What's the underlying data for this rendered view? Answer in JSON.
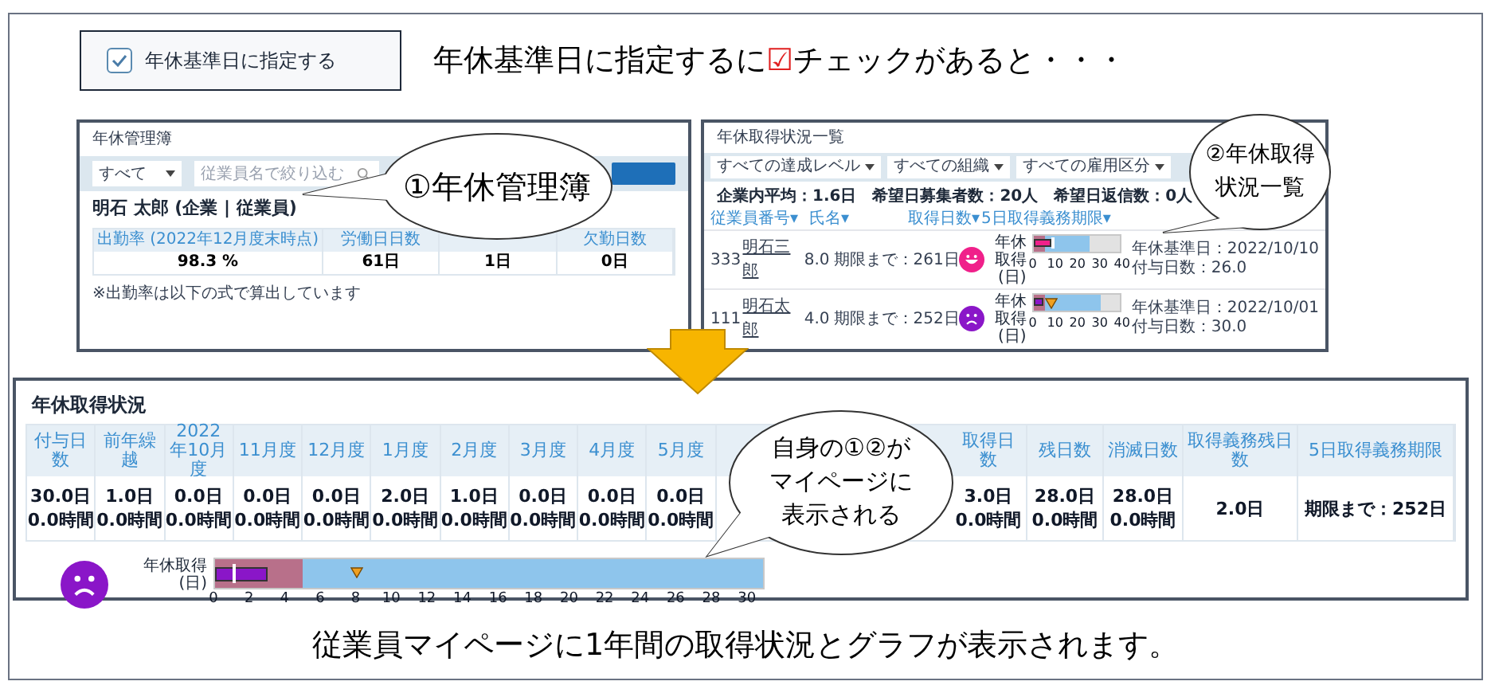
{
  "top": {
    "checkbox_card": {
      "label": "年休基準日に指定する",
      "checked": true
    },
    "headline": {
      "before": "年休基準日に指定するに",
      "mark": "☑",
      "after": "チェックがあると・・・"
    }
  },
  "ledger": {
    "title": "年休管理簿",
    "filter": "すべて",
    "search": {
      "placeholder": "従業員名で絞り込む"
    },
    "employee": "明石 太郎 (企業 | 従業員)",
    "stats": [
      {
        "header": "出勤率 (2022年12月度末時点)",
        "value": "98.3 %"
      },
      {
        "header": "労働日日数",
        "value": "61日"
      },
      {
        "value": "1日"
      },
      {
        "header": "欠勤日数",
        "value": "0日"
      }
    ],
    "note": "※出勤率は以下の式で算出しています"
  },
  "status_list": {
    "title": "年休取得状況一覧",
    "filters": [
      "すべての達成レベル",
      "すべての組織",
      "すべての雇用区分"
    ],
    "summary": "企業内平均：1.6日　希望日募集者数：20人　希望日返信数：0人",
    "columns": [
      "従業員番号▾",
      "氏名▾",
      "取得日数▾",
      "5日取得義務期限▾"
    ],
    "rows": [
      {
        "number": "333",
        "name": "明石三郎",
        "days": "8.0",
        "deadline": "期限まで：261日",
        "kind": "happy",
        "color": "#f0208a",
        "base_date": "年休基準日：2022/10/10",
        "granted": "付与日数：26.0",
        "gauge": {
          "label": "年休取得(日)",
          "level": 0.2,
          "segments": [
            {
              "level": 0.125
            },
            {
              "level": 0.65
            },
            {
              "level": 1
            }
          ],
          "line": {
            "level": 0.2
          },
          "ticks": [
            "0",
            "10",
            "20",
            "30",
            "40"
          ]
        }
      },
      {
        "number": "111",
        "name": "明石太郎",
        "days": "4.0",
        "deadline": "期限まで：252日",
        "kind": "sad",
        "color": "#8a16c8",
        "base_date": "年休基準日：2022/10/01",
        "granted": "付与日数：30.0",
        "gauge": {
          "label": "年休取得(日)",
          "level": 0.1,
          "segments": [
            {
              "level": 0.125
            },
            {
              "level": 0.775
            },
            {
              "level": 1
            }
          ],
          "marker": {
            "level": 0.2
          },
          "ticks": [
            "0",
            "10",
            "20",
            "30",
            "40"
          ]
        }
      }
    ]
  },
  "my_page": {
    "title": "年休取得状況",
    "columns": [
      {
        "header": "付与日数",
        "lines": [
          "30.0日",
          "0.0時間"
        ]
      },
      {
        "header": "前年繰越",
        "lines": [
          "1.0日",
          "0.0時間"
        ]
      },
      {
        "header": "2022年10月度",
        "lines": [
          "0.0日",
          "0.0時間"
        ]
      },
      {
        "header": "11月度",
        "lines": [
          "0.0日",
          "0.0時間"
        ]
      },
      {
        "header": "12月度",
        "lines": [
          "0.0日",
          "0.0時間"
        ]
      },
      {
        "header": "1月度",
        "lines": [
          "2.0日",
          "0.0時間"
        ]
      },
      {
        "header": "2月度",
        "lines": [
          "1.0日",
          "0.0時間"
        ]
      },
      {
        "header": "3月度",
        "lines": [
          "0.0日",
          "0.0時間"
        ]
      },
      {
        "header": "4月度",
        "lines": [
          "0.0日",
          "0.0時間"
        ]
      },
      {
        "header": "5月度",
        "lines": [
          "0.0日",
          "0.0時間"
        ]
      }
    ],
    "more_columns": [
      {
        "header": "取得日数",
        "lines": [
          "3.0日",
          "0.0時間"
        ]
      },
      {
        "header": "残日数",
        "lines": [
          "28.0日",
          "0.0時間"
        ]
      },
      {
        "header": "消滅日数",
        "lines": [
          "28.0日",
          "0.0時間"
        ]
      },
      {
        "header": "取得義務残日数",
        "lines": [
          "2.0日"
        ]
      },
      {
        "header": "5日取得義務期限",
        "lines": [
          "期限まで：252日"
        ]
      }
    ],
    "kind": "sad",
    "color": "#8a16c8",
    "gauge": {
      "label": "年休取得(日)",
      "level": 0.097,
      "segments": [
        {
          "level": 0.161
        },
        {
          "level": 1
        }
      ],
      "line": {
        "level": 0.032
      },
      "marker": {
        "level": 0.258
      },
      "ticks": [
        "0",
        "2",
        "4",
        "6",
        "8",
        "10",
        "12",
        "14",
        "16",
        "18",
        "20",
        "22",
        "24",
        "26",
        "28",
        "30"
      ]
    }
  },
  "bubbles": [
    {
      "kind": "ledger",
      "lines": [
        "①年休管理簿"
      ]
    },
    {
      "kind": "status",
      "lines": [
        "②年休取得",
        "状況一覧"
      ]
    },
    {
      "kind": "mypage",
      "lines": [
        "自身の①②が",
        "マイページに",
        "表示される"
      ]
    }
  ],
  "footer": "従業員マイページに1年間の取得状況とグラフが表示されます。"
}
